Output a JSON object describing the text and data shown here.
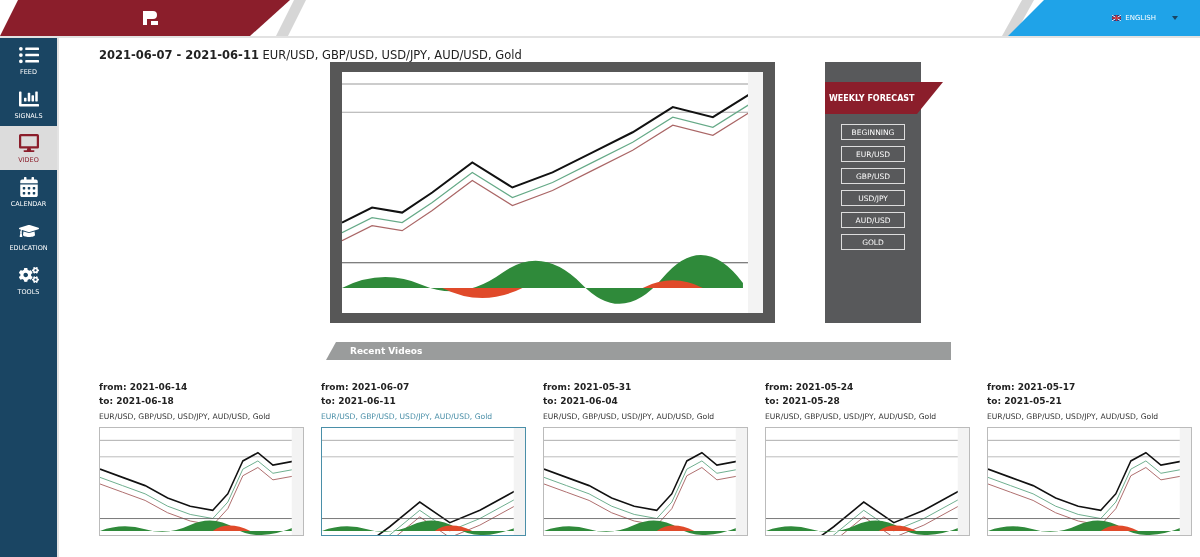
{
  "header": {
    "language": "ENGLISH"
  },
  "sidebar": {
    "items": [
      {
        "label": "FEED",
        "selected": false
      },
      {
        "label": "SIGNALS",
        "selected": false
      },
      {
        "label": "VIDEO",
        "selected": true
      },
      {
        "label": "CALENDAR",
        "selected": false
      },
      {
        "label": "EDUCATION",
        "selected": false
      },
      {
        "label": "TOOLS",
        "selected": false
      }
    ]
  },
  "current": {
    "dates": "2021-06-07 - 2021-06-11",
    "pairs": "EUR/USD, GBP/USD, USD/JPY, AUD/USD, Gold"
  },
  "forecast": {
    "title": "WEEKLY FORECAST",
    "buttons": [
      "BEGINNING",
      "EUR/USD",
      "GBP/USD",
      "USD/JPY",
      "AUD/USD",
      "GOLD"
    ]
  },
  "recent": {
    "title": "Recent Videos",
    "videos": [
      {
        "from": "from: 2021-06-14",
        "to": "to: 2021-06-18",
        "pairs": "EUR/USD, GBP/USD, USD/JPY, AUD/USD, Gold",
        "selected": false
      },
      {
        "from": "from: 2021-06-07",
        "to": "to: 2021-06-11",
        "pairs": "EUR/USD, GBP/USD, USD/JPY, AUD/USD, Gold",
        "selected": true
      },
      {
        "from": "from: 2021-05-31",
        "to": "to: 2021-06-04",
        "pairs": "EUR/USD, GBP/USD, USD/JPY, AUD/USD, Gold",
        "selected": false
      },
      {
        "from": "from: 2021-05-24",
        "to": "to: 2021-05-28",
        "pairs": "EUR/USD, GBP/USD, USD/JPY, AUD/USD, Gold",
        "selected": false
      },
      {
        "from": "from: 2021-05-17",
        "to": "to: 2021-05-21",
        "pairs": "EUR/USD, GBP/USD, USD/JPY, AUD/USD, Gold",
        "selected": false
      }
    ]
  }
}
